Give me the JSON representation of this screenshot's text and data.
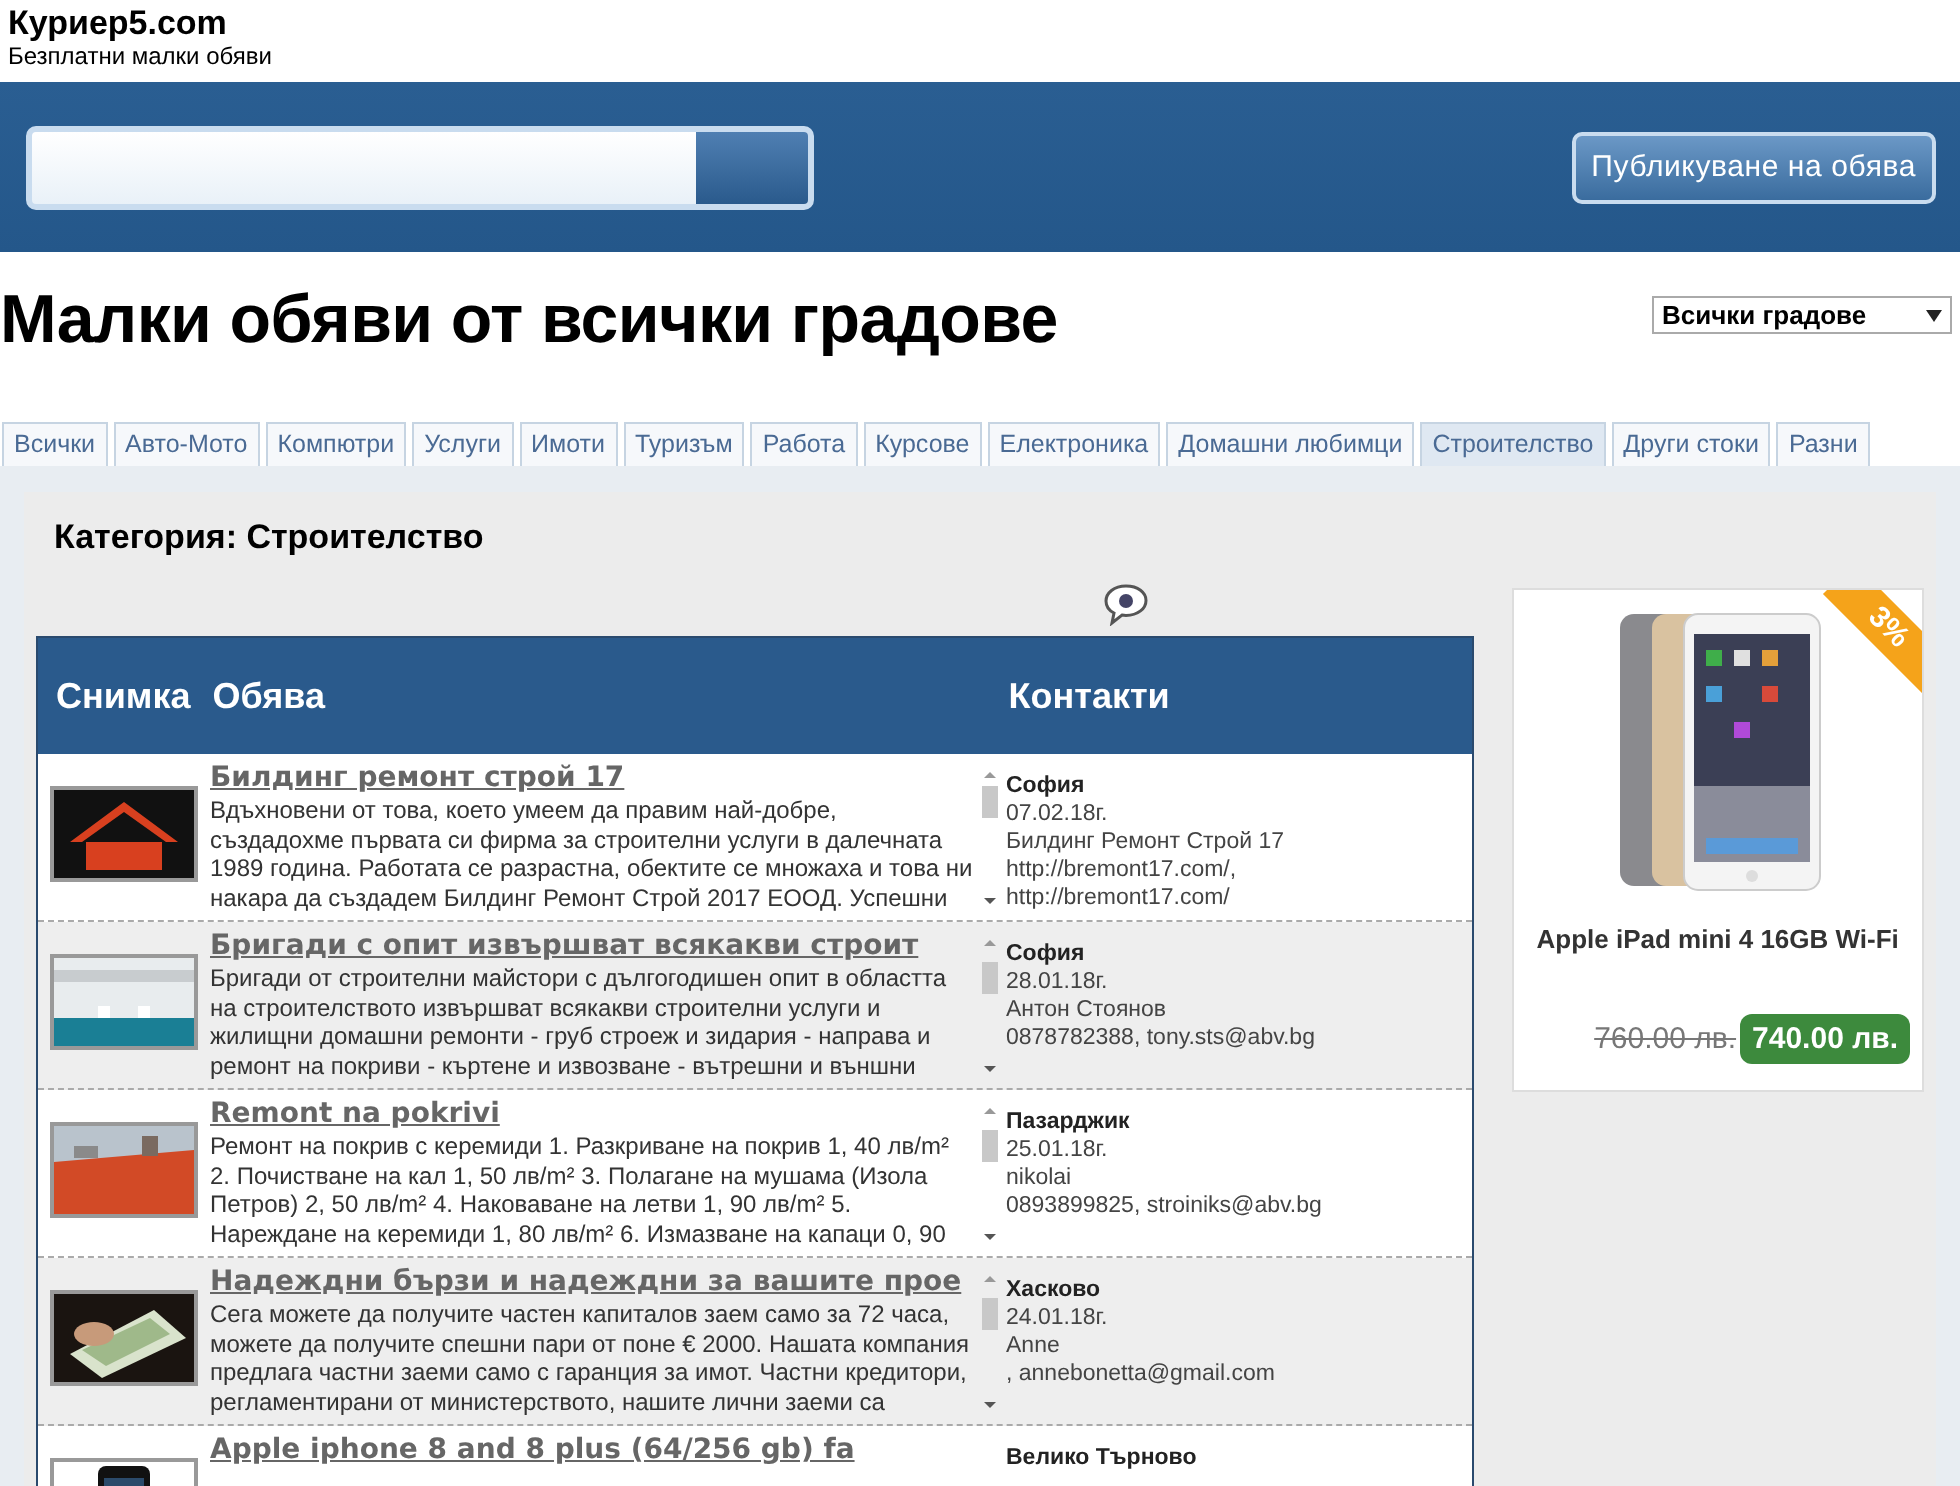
{
  "site": {
    "logo": "Куриер5.com",
    "tagline": "Безплатни малки обяви"
  },
  "publish_button": "Публикуване на обява",
  "heading": "Малки обяви от всички градове",
  "city_select": {
    "value": "Всички градове"
  },
  "tabs": [
    {
      "label": "Всички",
      "selected": false
    },
    {
      "label": "Авто-Мото",
      "selected": false
    },
    {
      "label": "Компютри",
      "selected": false
    },
    {
      "label": "Услуги",
      "selected": false
    },
    {
      "label": "Имоти",
      "selected": false
    },
    {
      "label": "Туризъм",
      "selected": false
    },
    {
      "label": "Работа",
      "selected": false
    },
    {
      "label": "Курсове",
      "selected": false
    },
    {
      "label": "Електроника",
      "selected": false
    },
    {
      "label": "Домашни любимци",
      "selected": false
    },
    {
      "label": "Строителство",
      "selected": true
    },
    {
      "label": "Други стоки",
      "selected": false
    },
    {
      "label": "Разни",
      "selected": false
    }
  ],
  "category_title": "Категория: Строителство",
  "table": {
    "columns": [
      "Снимка",
      "Обява",
      "Контакти"
    ],
    "rows": [
      {
        "title": "Билдинг ремонт строй 17",
        "description": "Вдъхновени от това, което умеем да правим най-добре, създадохме първата си фирма за строителни услуги в далечната 1989 година. Работата се разрастна, обектите се множаха и това ни накара да създадем Билдинг Ремонт Строй 2017 ЕООД. Успешни",
        "city": "София",
        "details": [
          "07.02.18г.",
          "Билдинг Ремонт Строй 17",
          "http://bremont17.com/,",
          "http://bremont17.com/"
        ]
      },
      {
        "title": "Бригади с опит извършват всякакви строит",
        "description": "Бригади от строителни майстори с дългогодишен опит в областта на строителството извършват всякакви строителни услуги и жилищни домашни ремонти - груб строеж и зидария - направа и ремонт на покриви - къртене и извозване - вътрешни и външни",
        "city": "София",
        "details": [
          "28.01.18г.",
          "Антон Стоянов",
          "0878782388, tony.sts@abv.bg"
        ]
      },
      {
        "title": "Remont na pokrivi",
        "description": "Ремонт на покрив с керемиди 1. Разкриване на покрив 1, 40 лв/m² 2. Почистване на кал 1, 50 лв/m² 3. Полагане на мушама (Изола Петров) 2, 50 лв/m² 4. Наковаване на летви 1, 90 лв/m² 5. Нареждане на керемиди 1, 80 лв/m² 6. Измазване на капаци 0, 90",
        "city": "Пазарджик",
        "details": [
          "25.01.18г.",
          "nikolai",
          "0893899825, stroiniks@abv.bg"
        ]
      },
      {
        "title": "Надеждни бързи и надеждни за вашите прое",
        "description": "Сега можете да получите частен капиталов заем само за 72 часа, можете да получите спешни пари от поне € 2000. Нашата компания предлага частни заеми само с гаранция за имот. Частни кредитори, регламентирани от министерството, нашите лични заеми са",
        "city": "Хасково",
        "details": [
          "24.01.18г.",
          "Anne",
          ", annebonetta@gmail.com"
        ]
      },
      {
        "title": "Apple iphone 8 and 8 plus (64/256 gb) fa",
        "city": "Велико Търново"
      }
    ]
  },
  "ad": {
    "title": "Apple iPad mini 4 16GB Wi-Fi",
    "old_price": "760.00 лв.",
    "price": "740.00 лв.",
    "discount": "3%"
  }
}
